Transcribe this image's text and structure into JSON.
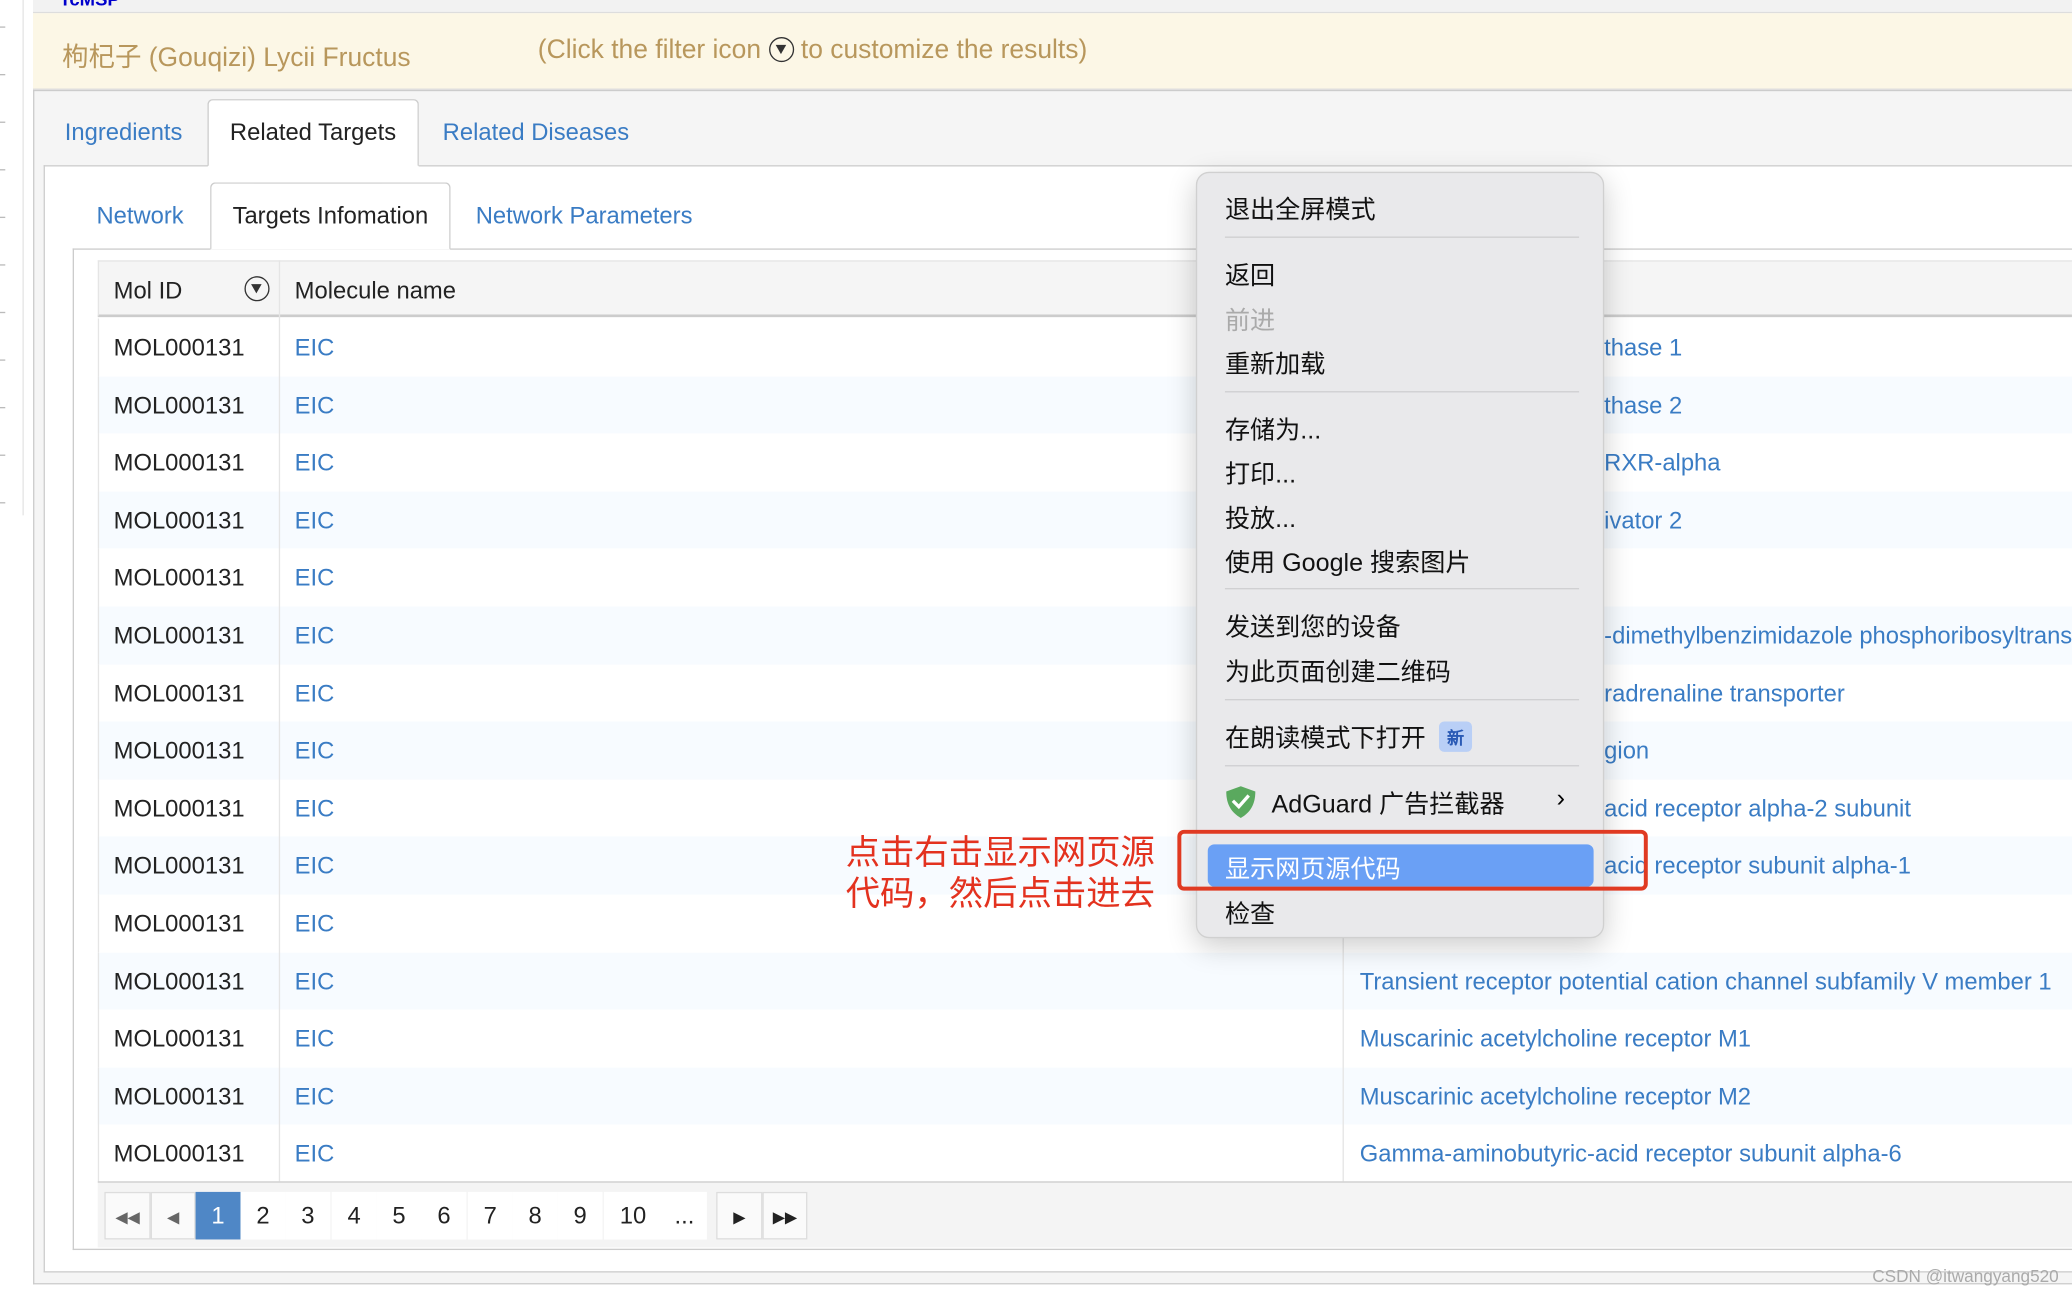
{
  "topbar": {
    "text": "TcMSP"
  },
  "banner": {
    "herb": "枸杞子 (Gouqizi) Lycii Fructus",
    "hint_before": "(Click the filter icon",
    "hint_after": "to customize the results)"
  },
  "tabs": [
    {
      "label": "Ingredients"
    },
    {
      "label": "Related Targets",
      "active": true
    },
    {
      "label": "Related Diseases"
    }
  ],
  "subtabs": [
    {
      "label": "Network"
    },
    {
      "label": "Targets Infomation",
      "active": true
    },
    {
      "label": "Network Parameters"
    }
  ],
  "table": {
    "headers": [
      "Mol ID",
      "Molecule name"
    ],
    "rows": [
      {
        "mol_id": "MOL000131",
        "name": "EIC",
        "target": "thase 1"
      },
      {
        "mol_id": "MOL000131",
        "name": "EIC",
        "target": "thase 2"
      },
      {
        "mol_id": "MOL000131",
        "name": "EIC",
        "target": "RXR-alpha"
      },
      {
        "mol_id": "MOL000131",
        "name": "EIC",
        "target": "ivator 2"
      },
      {
        "mol_id": "MOL000131",
        "name": "EIC",
        "target": ""
      },
      {
        "mol_id": "MOL000131",
        "name": "EIC",
        "target": "-dimethylbenzimidazole phosphoribosyltrans"
      },
      {
        "mol_id": "MOL000131",
        "name": "EIC",
        "target": "radrenaline transporter"
      },
      {
        "mol_id": "MOL000131",
        "name": "EIC",
        "target": "gion"
      },
      {
        "mol_id": "MOL000131",
        "name": "EIC",
        "target": "acid receptor alpha-2 subunit"
      },
      {
        "mol_id": "MOL000131",
        "name": "EIC",
        "target": "acid receptor subunit alpha-1"
      },
      {
        "mol_id": "MOL000131",
        "name": "EIC",
        "target": ""
      },
      {
        "mol_id": "MOL000131",
        "name": "EIC",
        "target": "Transient receptor potential cation channel subfamily V member 1"
      },
      {
        "mol_id": "MOL000131",
        "name": "EIC",
        "target": "Muscarinic acetylcholine receptor M1"
      },
      {
        "mol_id": "MOL000131",
        "name": "EIC",
        "target": "Muscarinic acetylcholine receptor M2"
      },
      {
        "mol_id": "MOL000131",
        "name": "EIC",
        "target": "Gamma-aminobutyric-acid receptor subunit alpha-6"
      }
    ]
  },
  "pagination": {
    "pages": [
      "1",
      "2",
      "3",
      "4",
      "5",
      "6",
      "7",
      "8",
      "9",
      "10",
      "..."
    ],
    "current": "1"
  },
  "context_menu": {
    "exit_fullscreen": "退出全屏模式",
    "back": "返回",
    "forward": "前进",
    "reload": "重新加载",
    "save_as": "存储为...",
    "print": "打印...",
    "cast": "投放...",
    "google_image": "使用 Google 搜索图片",
    "send_device": "发送到您的设备",
    "qr": "为此页面创建二维码",
    "reader": "在朗读模式下打开",
    "new_badge": "新",
    "adguard": "AdGuard 广告拦截器",
    "view_source": "显示网页源代码",
    "inspect": "检查"
  },
  "annotation": "点击右击显示网页源代码，然后点击进去",
  "watermark": "CSDN @itwangyang520",
  "colors": {
    "link": "#3a7cc4",
    "banner_text": "#b8975c",
    "highlight": "#6aa0f5",
    "annotation": "#e3321f"
  }
}
